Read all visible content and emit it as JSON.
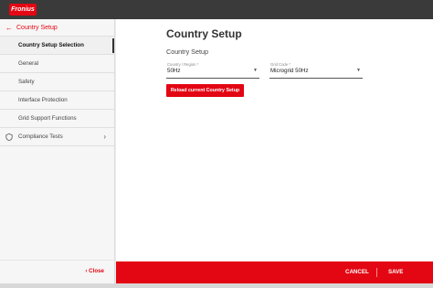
{
  "brand": {
    "logo_text": "Fronius",
    "accent": "#e30613"
  },
  "sidebar": {
    "back_label": "Country Setup",
    "items": [
      {
        "label": "Country Setup Selection",
        "active": true
      },
      {
        "label": "General"
      },
      {
        "label": "Safety"
      },
      {
        "label": "Interface Protection"
      },
      {
        "label": "Grid Support Functions"
      },
      {
        "label": "Compliance Tests",
        "icon": "shield-icon",
        "has_chevron": true
      }
    ],
    "close_label": "Close"
  },
  "main": {
    "title": "Country Setup",
    "subtitle": "Country Setup",
    "country_field": {
      "label": "Country / Region *",
      "value": "50Hz"
    },
    "grid_code_field": {
      "label": "Grid Code *",
      "value": "Microgrid 50Hz"
    },
    "reload_label": "Reload current Country Setup"
  },
  "footer": {
    "cancel_label": "CANCEL",
    "save_label": "SAVE"
  }
}
